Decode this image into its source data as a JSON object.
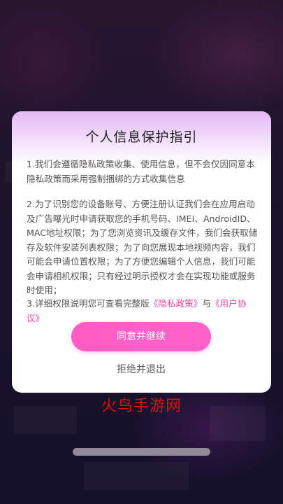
{
  "dialog": {
    "title": "个人信息保护指引",
    "para1": "1.我们会遵循隐私政策收集、使用信息，但不会仅因同意本隐私政策而采用强制捆绑的方式收集信息",
    "para2": "2.为了识别您的设备账号、方便注册认证我们会在应用启动及广告曝光时申请获取您的手机号码、IMEI、AndroidID、MAC地址权限；为了您浏览资讯及缓存文件，我们会获取储存及软件安装列表权限；为了向您展现本地视频内容，我们可能会申请位置权限；为了方便您编辑个人信息，我们可能会申请相机权限；只有经过明示授权才会在实现功能或服务时使用；",
    "para3_prefix": "3.详细权限说明您可查看完整版",
    "privacy_link": "《隐私政策》",
    "para3_mid": "与",
    "terms_link": "《用户协议》",
    "agree_label": "同意并继续",
    "reject_label": "拒绝并退出"
  },
  "watermark": "火鸟手游网",
  "colors": {
    "accent": "#f4479c",
    "button": "#ff5cc4",
    "watermark": "#e01010"
  }
}
